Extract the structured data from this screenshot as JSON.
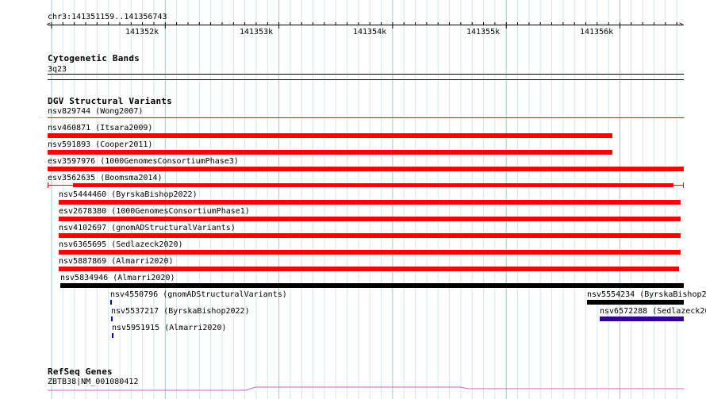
{
  "ruler": {
    "location": "chr3:141351159..141356743",
    "ticks": [
      "141352k",
      "141353k",
      "141354k",
      "141355k",
      "141356k"
    ]
  },
  "cytoband": {
    "title": "Cytogenetic Bands",
    "band": "3q23"
  },
  "dgv": {
    "title": "DGV Structural Variants",
    "features": [
      {
        "name": "nsv829744 (Wong2007)",
        "color": "#ff0000"
      },
      {
        "name": "nsv460871 (Itsara2009)",
        "color": "#ff0000"
      },
      {
        "name": "nsv591893 (Cooper2011)",
        "color": "#ff0000"
      },
      {
        "name": "esv3597976 (1000GenomesConsortiumPhase3)",
        "color": "#ff0000"
      },
      {
        "name": "esv3562635 (Boomsma2014)",
        "color": "#ff0000"
      },
      {
        "name": "nsv5444460 (ByrskaBishop2022)",
        "color": "#ff0000"
      },
      {
        "name": "esv2678380 (1000GenomesConsortiumPhase1)",
        "color": "#ff0000"
      },
      {
        "name": "nsv4102697 (gnomADStructuralVariants)",
        "color": "#ff0000"
      },
      {
        "name": "nsv6365695 (Sedlazeck2020)",
        "color": "#ff0000"
      },
      {
        "name": "nsv5887869 (Almarri2020)",
        "color": "#ff0000"
      },
      {
        "name": "nsv5834946 (Almarri2020)",
        "color": "#000000"
      },
      {
        "name": "nsv4550796 (gnomADStructuralVariants)",
        "color": "#0000cc"
      },
      {
        "name": "nsv5537217 (ByrskaBishop2022)",
        "color": "#0000cc"
      },
      {
        "name": "nsv5951915 (Almarri2020)",
        "color": "#0000cc"
      },
      {
        "name": "nsv5554234 (ByrskaBishop2",
        "color": "#000000"
      },
      {
        "name": "nsv6572288 (Sedlazeck20",
        "color": "#330099"
      }
    ]
  },
  "refseq": {
    "title": "RefSeq Genes",
    "gene": "ZBTB38|NM_001080412",
    "color": "#cc66cc"
  }
}
